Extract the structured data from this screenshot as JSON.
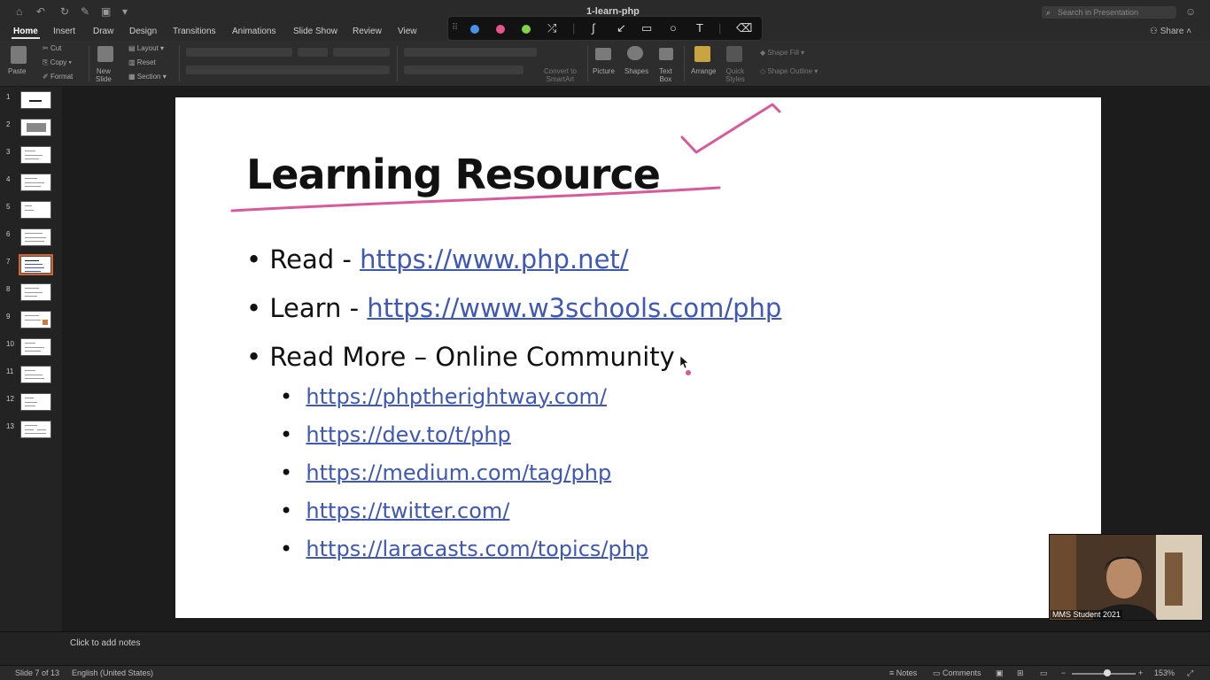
{
  "window": {
    "title": "1-learn-php"
  },
  "search": {
    "placeholder": "Search in Presentation"
  },
  "tabs": [
    "Home",
    "Insert",
    "Draw",
    "Design",
    "Transitions",
    "Animations",
    "Slide Show",
    "Review",
    "View"
  ],
  "active_tab": "Home",
  "share_label": "Share",
  "ribbon": {
    "paste": "Paste",
    "cut": "Cut",
    "copy": "Copy",
    "format": "Format",
    "new_slide": [
      "New",
      "Slide"
    ],
    "layout": "Layout",
    "reset": "Reset",
    "section": "Section",
    "convert": [
      "Convert to",
      "SmartArt"
    ],
    "picture": "Picture",
    "shapes": "Shapes",
    "text_box": [
      "Text",
      "Box"
    ],
    "arrange": "Arrange",
    "quick_styles": [
      "Quick",
      "Styles"
    ],
    "shape_fill": "Shape Fill",
    "shape_outline": "Shape Outline"
  },
  "ink_toolbar": {
    "pen_colors": [
      "#4a8fe8",
      "#e8558e",
      "#7ed34a"
    ],
    "tools": [
      "shuffle-icon",
      "pen-icon",
      "arrow-icon",
      "rectangle-icon",
      "circle-icon",
      "text-icon",
      "eraser-icon"
    ]
  },
  "slides": {
    "count": 13,
    "selected": 7,
    "numbers": [
      "1",
      "2",
      "3",
      "4",
      "5",
      "6",
      "7",
      "8",
      "9",
      "10",
      "11",
      "12",
      "13"
    ]
  },
  "slide": {
    "title": "Learning Resource",
    "bullets": [
      {
        "label": "Read - ",
        "link": "https://www.php.net/"
      },
      {
        "label": "Learn - ",
        "link": "https://www.w3schools.com/php"
      },
      {
        "label": "Read More – Online Community",
        "link": ""
      }
    ],
    "sub_links": [
      "https://phptherightway.com/",
      "https://dev.to/t/php",
      "https://medium.com/tag/php",
      "https://twitter.com/",
      "https://laracasts.com/topics/php"
    ],
    "ink_color": "#d95a9b"
  },
  "webcam": {
    "name": "MMS Student 2021"
  },
  "notes": {
    "placeholder": "Click to add notes"
  },
  "status": {
    "slide_info": "Slide 7 of 13",
    "language": "English (United States)",
    "notes": "Notes",
    "comments": "Comments",
    "zoom": "153%"
  }
}
